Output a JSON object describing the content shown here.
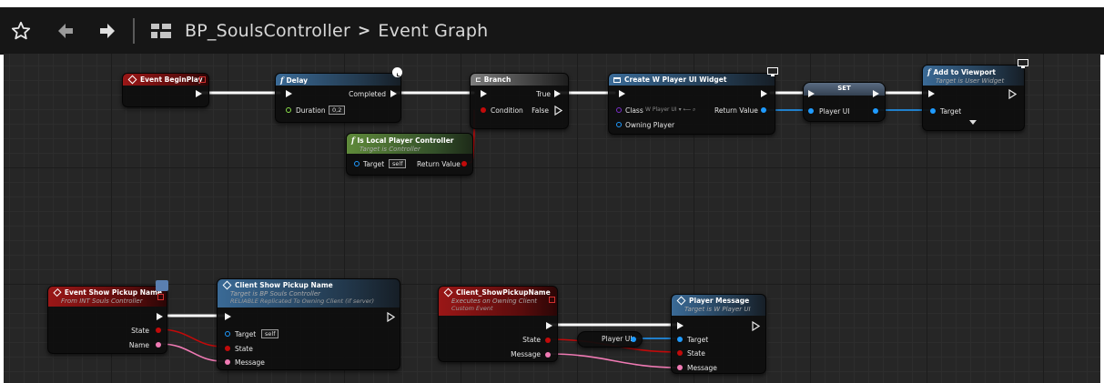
{
  "toolbar": {
    "favorite_icon": "star-outline-icon",
    "back_icon": "arrow-left-icon",
    "forward_icon": "arrow-right-icon",
    "blueprint_icon": "blueprint-graph-icon"
  },
  "breadcrumb": {
    "blueprint": "BP_SoulsController",
    "separator": ">",
    "graph": "Event Graph"
  },
  "colors": {
    "event_header": "#7a1212",
    "function_header": "#3f5f7a",
    "pure_header": "#4f6e2d",
    "exec_wire": "#ffffff",
    "object_pin": "#1f9bff",
    "bool_pin": "#c10a0a",
    "string_pin": "#f07ab4",
    "float_pin": "#8be04a",
    "class_pin": "#7b2fc9"
  },
  "nodes": {
    "event_begin_play": {
      "title": "Event BeginPlay"
    },
    "delay": {
      "title": "Delay",
      "completed": "Completed",
      "duration_label": "Duration",
      "duration_value": "0,2"
    },
    "branch": {
      "title": "Branch",
      "condition": "Condition",
      "true_label": "True",
      "false_label": "False"
    },
    "is_local": {
      "title": "Is Local Player Controller",
      "subtitle": "Target is Controller",
      "target": "Target",
      "self_value": "self",
      "return_value": "Return Value"
    },
    "create_widget": {
      "title": "Create W Player UI Widget",
      "class_label": "Class",
      "class_value": "W Player UI",
      "return_value": "Return Value",
      "owning_player": "Owning Player"
    },
    "set_node": {
      "title": "SET",
      "player_ui": "Player UI"
    },
    "add_to_viewport": {
      "title": "Add to Viewport",
      "subtitle": "Target is User Widget",
      "target": "Target"
    },
    "event_show_pickup": {
      "title": "Event Show Pickup Name",
      "subtitle": "From INT Souls Controller",
      "state": "State",
      "name": "Name"
    },
    "client_show_pickup": {
      "title": "Client Show Pickup Name",
      "subtitle": "Target is BP Souls Controller",
      "subtitle2": "RELIABLE Replicated To Owning Client (if server)",
      "target": "Target",
      "self_value": "self",
      "state": "State",
      "message": "Message"
    },
    "client_event": {
      "title": "Client_ShowPickupName",
      "subtitle": "Executes on Owning Client",
      "subtitle2": "Custom Event",
      "state": "State",
      "message": "Message"
    },
    "player_ui_var": {
      "label": "Player UI"
    },
    "player_message": {
      "title": "Player Message",
      "subtitle": "Target is W Player UI",
      "target": "Target",
      "state": "State",
      "message": "Message"
    }
  }
}
